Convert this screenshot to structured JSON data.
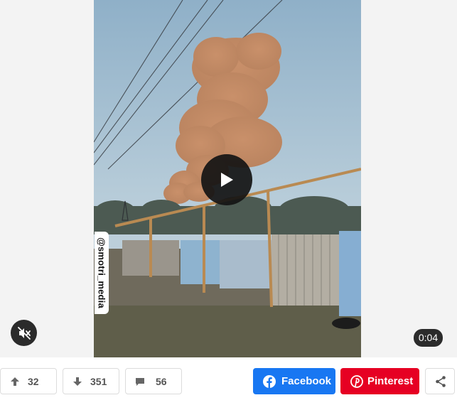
{
  "video": {
    "watermark": "@smotri_media",
    "duration": "0:04",
    "play_icon": "play-icon",
    "mute_icon": "muted-speaker-icon"
  },
  "votes": {
    "upvotes": "32",
    "downvotes": "351",
    "comments": "56",
    "upvote_icon": "arrow-up-icon",
    "downvote_icon": "arrow-down-icon",
    "comment_icon": "speech-bubble-icon"
  },
  "share": {
    "facebook_label": "Facebook",
    "pinterest_label": "Pinterest",
    "more_icon": "share-icon"
  },
  "colors": {
    "facebook": "#1877f2",
    "pinterest": "#e60023",
    "vote_text": "#555555",
    "player_background": "#f3f3f3",
    "overlay": "#2b2b2b"
  }
}
